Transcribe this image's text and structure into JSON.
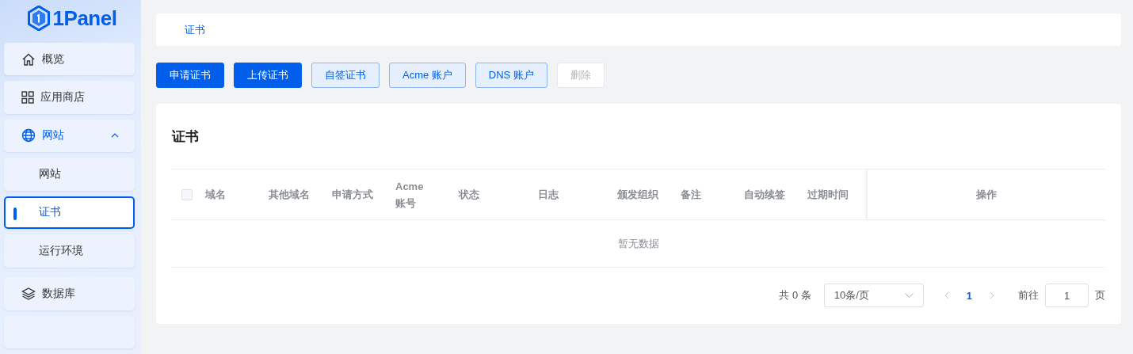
{
  "logo": {
    "text": "1Panel"
  },
  "sidebar": {
    "items": [
      {
        "label": "概览",
        "selected": false
      },
      {
        "label": "应用商店",
        "selected": false
      },
      {
        "label": "网站",
        "selected": false,
        "expanded": true,
        "children": [
          {
            "label": "网站",
            "selected": false
          },
          {
            "label": "证书",
            "selected": true
          },
          {
            "label": "运行环境",
            "selected": false
          }
        ]
      },
      {
        "label": "数据库",
        "selected": false
      }
    ]
  },
  "breadcrumb": "证书",
  "toolbar": [
    {
      "label": "申请证书",
      "kind": "primary",
      "disabled": false
    },
    {
      "label": "上传证书",
      "kind": "primary",
      "disabled": false
    },
    {
      "label": "自签证书",
      "kind": "plain",
      "disabled": false
    },
    {
      "label": "Acme 账户",
      "kind": "plain",
      "disabled": false
    },
    {
      "label": "DNS 账户",
      "kind": "plain",
      "disabled": false
    },
    {
      "label": "删除",
      "kind": "plain",
      "disabled": true
    }
  ],
  "card": {
    "title": "证书"
  },
  "table": {
    "select_all": {
      "checked": false
    },
    "columns": [
      "域名",
      "其他域名",
      "申请方式",
      "Acme 账号",
      "状态",
      "日志",
      "颁发组织",
      "备注",
      "自动续签",
      "过期时间",
      "操作"
    ],
    "empty_text": "暂无数据"
  },
  "pagination": {
    "total": "共 0 条",
    "page_size": "10条/页",
    "pages": [
      {
        "label": "1",
        "selected": true
      }
    ],
    "goto_label": "前往",
    "goto_value": "1",
    "page_suffix": "页"
  }
}
